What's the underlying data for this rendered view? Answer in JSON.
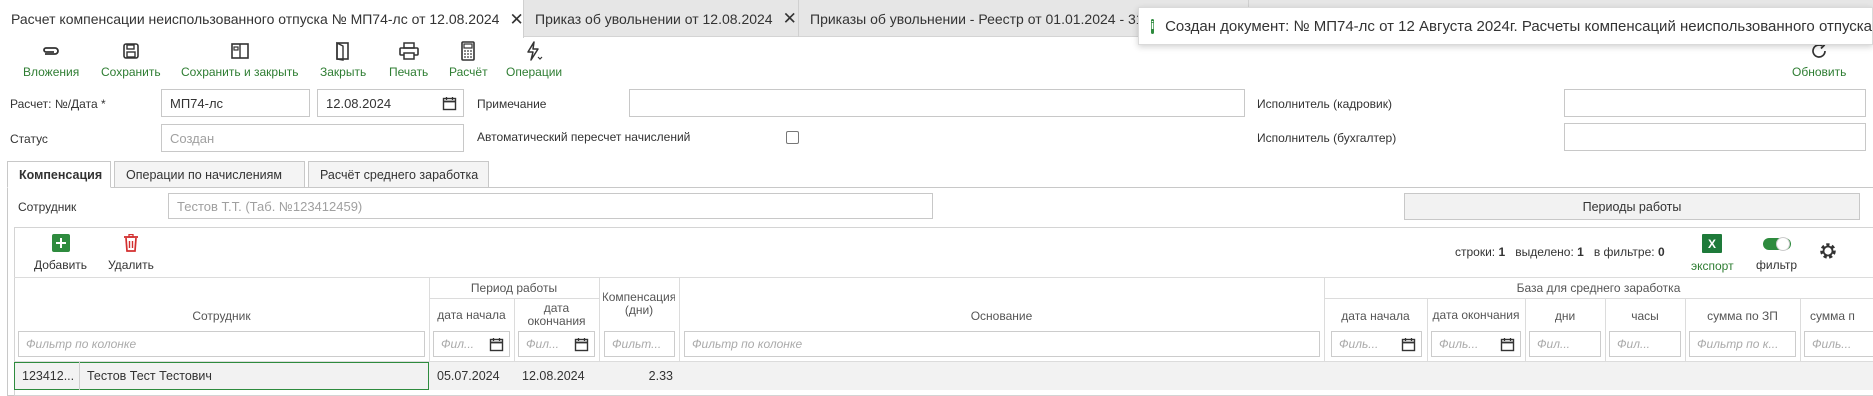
{
  "tabs": [
    {
      "label": "Расчет компенсации неиспользованного отпуска № МП74-лс от 12.08.2024",
      "close": "✕"
    },
    {
      "label": "Приказ об увольнении от 12.08.2024",
      "close": "✕"
    },
    {
      "label": "Приказы об увольнении - Реестр от 01.01.2024 - 31.",
      "close": ""
    }
  ],
  "toast": {
    "icon": "i",
    "text": "Создан документ: № МП74-лс от 12 Августа 2024г. Расчеты компенсаций неиспользованного отпуска"
  },
  "toolbar": {
    "attachments": "Вложения",
    "save": "Сохранить",
    "save_close": "Сохранить и закрыть",
    "close": "Закрыть",
    "print": "Печать",
    "calc": "Расчёт",
    "operations": "Операции",
    "refresh": "Обновить"
  },
  "form": {
    "calc_label": "Расчет: №/Дата *",
    "number": "МП74-лс",
    "date": "12.08.2024",
    "note_label": "Примечание",
    "note_value": "",
    "hr_label": "Исполнитель (кадровик)",
    "hr_value": "",
    "status_label": "Статус",
    "status_placeholder": "Создан",
    "auto_recalc_label": "Автоматический пересчет начислений",
    "accountant_label": "Исполнитель (бухгалтер)",
    "accountant_value": ""
  },
  "inner_tabs": [
    "Компенсация",
    "Операции по начислениям",
    "Расчёт среднего заработка"
  ],
  "employee": {
    "label": "Сотрудник",
    "placeholder": "Тестов Т.Т. (Таб. №123412459)",
    "periods_button": "Периоды работы"
  },
  "grid_toolbar": {
    "add": "Добавить",
    "delete": "Удалить",
    "rows_label": "строки:",
    "rows_value": "1",
    "selected_label": "выделено:",
    "selected_value": "1",
    "filtered_label": "в фильтре:",
    "filtered_value": "0",
    "export": "экспорт",
    "filter": "фильтр"
  },
  "grid": {
    "headers": {
      "employee": "Сотрудник",
      "work_period": "Период работы",
      "wp_start": "дата начала",
      "wp_end": "дата окончания",
      "comp_days": "Компенсация (дни)",
      "basis": "Основание",
      "avg_base": "База для среднего заработка",
      "base_start": "дата начала",
      "base_end": "дата окончания",
      "days": "дни",
      "hours": "часы",
      "zp_sum": "сумма по ЗП",
      "sum_p": "сумма п"
    },
    "filters": {
      "column": "Фильтр по колонке",
      "short1": "Филь...",
      "short2": "Фил...",
      "short3": "Фильт...",
      "short4": "Фильтр по к...",
      "short5": "Фил..."
    },
    "rows": [
      {
        "tab": "123412...",
        "name": "Тестов Тест Тестович",
        "start": "05.07.2024",
        "end": "12.08.2024",
        "days": "2.33"
      }
    ]
  },
  "colors": {
    "accent": "#2e7d32",
    "delete": "#d32f2f",
    "tab_bar": "#e6e6e6"
  }
}
